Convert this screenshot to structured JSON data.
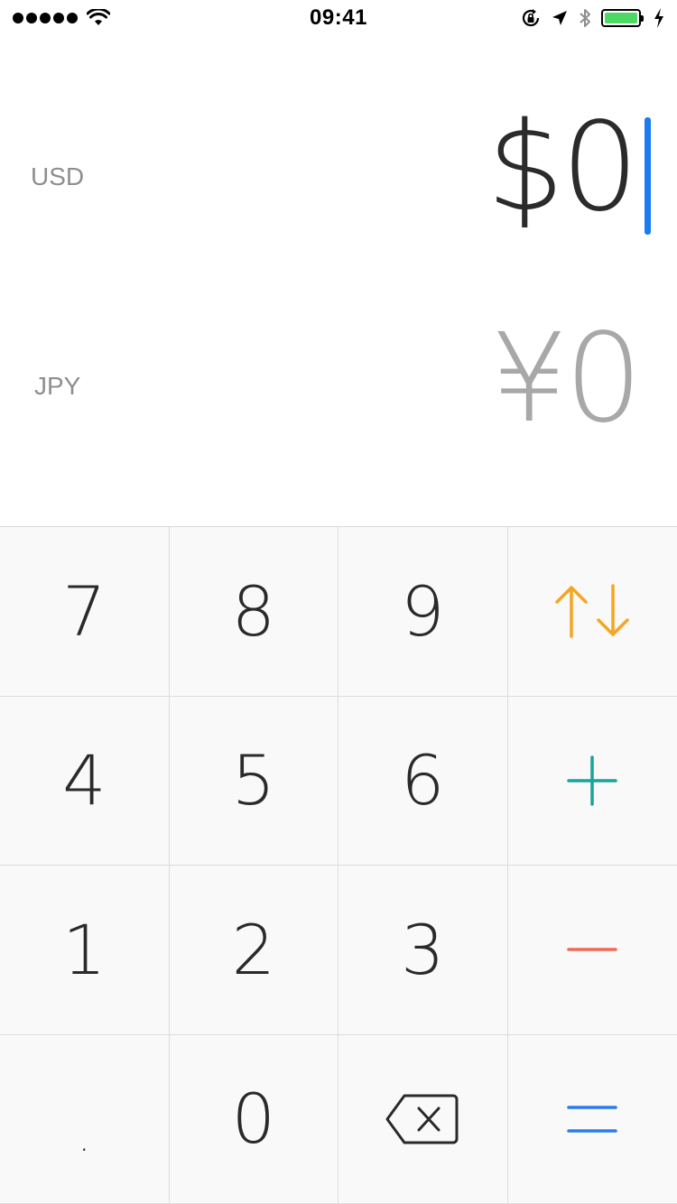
{
  "status_bar": {
    "time": "09:41",
    "icons": [
      "signal-icon",
      "wifi-icon",
      "rotation-lock-icon",
      "location-icon",
      "bluetooth-icon",
      "battery-icon",
      "charging-icon"
    ],
    "battery_color": "#4cd964"
  },
  "source": {
    "code": "USD",
    "amount": "$0"
  },
  "target": {
    "code": "JPY",
    "amount": "¥0"
  },
  "keypad": {
    "k7": "7",
    "k8": "8",
    "k9": "9",
    "k4": "4",
    "k5": "5",
    "k6": "6",
    "k1": "1",
    "k2": "2",
    "k3": "3",
    "kdot": ".",
    "k0": "0",
    "swap_icon": "swap-arrows-icon",
    "plus_icon": "plus-icon",
    "minus_icon": "minus-icon",
    "backspace_icon": "backspace-icon",
    "equals_icon": "equals-icon"
  },
  "colors": {
    "caret": "#1a7cf0",
    "swap": "#f5a623",
    "plus": "#1aa39a",
    "minus": "#f06a55",
    "equals": "#2b7de9"
  }
}
